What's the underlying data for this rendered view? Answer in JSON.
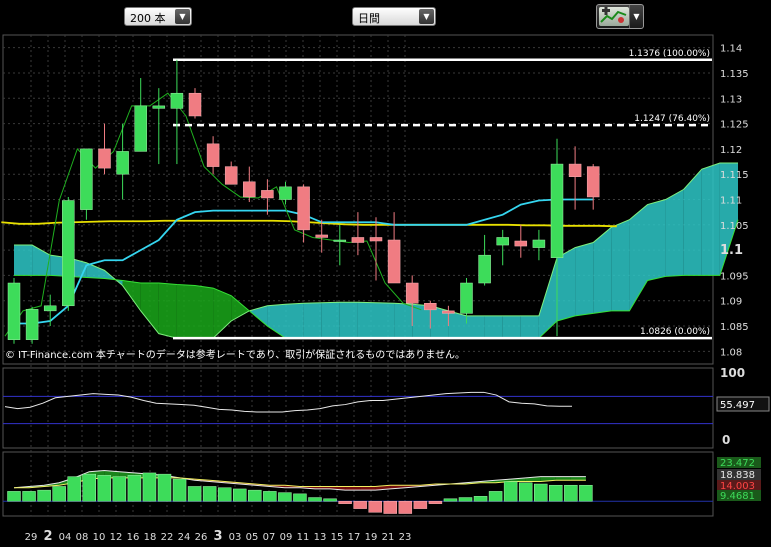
{
  "toolbar": {
    "bars_select": "200 本",
    "timeframe_select": "日間",
    "tool_icon": "chart-tools-icon"
  },
  "copyright": "© IT-Finance.com  本チャートのデータは参考レートであり、取引が保証されるものではありません。",
  "colors": {
    "up": "#3ddc5a",
    "down": "#f07c82",
    "tenkan": "#35d6f0",
    "kijun": "#e8e000",
    "cloud_teal": "#2ec8c8",
    "cloud_green": "#1aa81a",
    "grid": "#3a3a3a",
    "blue_line": "#3333cc"
  },
  "chart_data": [
    {
      "type": "candlestick",
      "title": "",
      "y_ticks": [
        "1.14",
        "1.135",
        "1.13",
        "1.125",
        "1.12",
        "1.115",
        "1.11",
        "1.105",
        "1.1",
        "1.095",
        "1.09",
        "1.085",
        "1.08"
      ],
      "ylim": [
        1.0775,
        1.1425
      ],
      "x_ticks": [
        "29",
        "2",
        "04",
        "08",
        "10",
        "12",
        "16",
        "18",
        "22",
        "24",
        "26",
        "3",
        "03",
        "05",
        "07",
        "09",
        "11",
        "13",
        "15",
        "17",
        "19",
        "21",
        "23"
      ],
      "fib_levels": [
        {
          "label": "1.1376 (100.00%)",
          "value": 1.1376
        },
        {
          "label": "1.1247 (76.40%)",
          "value": 1.1247
        },
        {
          "label": "1.0826 (0.00%)",
          "value": 1.0826
        }
      ],
      "candles": [
        {
          "o": 1.0823,
          "h": 1.0945,
          "l": 1.0815,
          "c": 1.0935
        },
        {
          "o": 1.0823,
          "h": 1.0888,
          "l": 1.0815,
          "c": 1.0883
        },
        {
          "o": 1.088,
          "h": 1.0912,
          "l": 1.085,
          "c": 1.089
        },
        {
          "o": 1.089,
          "h": 1.1105,
          "l": 1.088,
          "c": 1.1098
        },
        {
          "o": 1.108,
          "h": 1.12,
          "l": 1.106,
          "c": 1.12
        },
        {
          "o": 1.12,
          "h": 1.125,
          "l": 1.115,
          "c": 1.1162
        },
        {
          "o": 1.115,
          "h": 1.125,
          "l": 1.11,
          "c": 1.1195
        },
        {
          "o": 1.1195,
          "h": 1.134,
          "l": 1.1195,
          "c": 1.1285
        },
        {
          "o": 1.128,
          "h": 1.132,
          "l": 1.117,
          "c": 1.1285
        },
        {
          "o": 1.128,
          "h": 1.1376,
          "l": 1.117,
          "c": 1.131
        },
        {
          "o": 1.131,
          "h": 1.132,
          "l": 1.126,
          "c": 1.1265
        },
        {
          "o": 1.121,
          "h": 1.1225,
          "l": 1.115,
          "c": 1.1165
        },
        {
          "o": 1.1165,
          "h": 1.1175,
          "l": 1.113,
          "c": 1.113
        },
        {
          "o": 1.1135,
          "h": 1.1165,
          "l": 1.1095,
          "c": 1.1105
        },
        {
          "o": 1.1118,
          "h": 1.114,
          "l": 1.107,
          "c": 1.1103
        },
        {
          "o": 1.11,
          "h": 1.1135,
          "l": 1.109,
          "c": 1.1125
        },
        {
          "o": 1.1125,
          "h": 1.113,
          "l": 1.1015,
          "c": 1.104
        },
        {
          "o": 1.103,
          "h": 1.106,
          "l": 1.0995,
          "c": 1.1025
        },
        {
          "o": 1.102,
          "h": 1.105,
          "l": 1.097,
          "c": 1.102
        },
        {
          "o": 1.1025,
          "h": 1.1075,
          "l": 1.099,
          "c": 1.1015
        },
        {
          "o": 1.1025,
          "h": 1.1065,
          "l": 1.094,
          "c": 1.1018
        },
        {
          "o": 1.102,
          "h": 1.1075,
          "l": 1.0935,
          "c": 1.0935
        },
        {
          "o": 1.0935,
          "h": 1.095,
          "l": 1.085,
          "c": 1.0895
        },
        {
          "o": 1.0895,
          "h": 1.09,
          "l": 1.0845,
          "c": 1.0882
        },
        {
          "o": 1.088,
          "h": 1.089,
          "l": 1.085,
          "c": 1.0875
        },
        {
          "o": 1.0875,
          "h": 1.0945,
          "l": 1.0855,
          "c": 1.0935
        },
        {
          "o": 1.0935,
          "h": 1.103,
          "l": 1.093,
          "c": 1.099
        },
        {
          "o": 1.101,
          "h": 1.104,
          "l": 1.097,
          "c": 1.1025
        },
        {
          "o": 1.1018,
          "h": 1.105,
          "l": 1.0985,
          "c": 1.1008
        },
        {
          "o": 1.1005,
          "h": 1.104,
          "l": 1.098,
          "c": 1.102
        },
        {
          "o": 1.0985,
          "h": 1.122,
          "l": 1.083,
          "c": 1.117
        },
        {
          "o": 1.117,
          "h": 1.1205,
          "l": 1.108,
          "c": 1.1145
        },
        {
          "o": 1.1165,
          "h": 1.117,
          "l": 1.108,
          "c": 1.1105
        }
      ],
      "tenkan": [
        1.0855,
        1.0855,
        1.086,
        1.089,
        1.097,
        1.098,
        1.098,
        1.1,
        1.102,
        1.106,
        1.1075,
        1.1078,
        1.1078,
        1.1078,
        1.1078,
        1.1078,
        1.107,
        1.1055,
        1.1055,
        1.1055,
        1.1055,
        1.105,
        1.105,
        1.105,
        1.105,
        1.105,
        1.106,
        1.107,
        1.109,
        1.1098,
        1.11,
        1.11,
        1.11
      ],
      "kijun": [
        1.1055,
        1.1052,
        1.1052,
        1.1054,
        1.1055,
        1.1056,
        1.1057,
        1.1057,
        1.1057,
        1.1058,
        1.1058,
        1.1058,
        1.1058,
        1.1058,
        1.1058,
        1.1058,
        1.1057,
        1.1055,
        1.1053,
        1.1051,
        1.105,
        1.105,
        1.105,
        1.105,
        1.105,
        1.105,
        1.105,
        1.105,
        1.105,
        1.1049,
        1.1049,
        1.1048,
        1.1048,
        1.1048,
        1.1047
      ],
      "cloud_a": [
        1.101,
        1.101,
        1.099,
        1.0985,
        1.0975,
        1.096,
        1.093,
        1.088,
        1.0835,
        1.0826,
        1.0826,
        1.0826,
        1.086,
        1.088,
        1.089,
        1.0893,
        1.0895,
        1.0896,
        1.0897,
        1.0897,
        1.0896,
        1.0895,
        1.0893,
        1.089,
        1.088,
        1.087,
        1.087,
        1.087,
        1.087,
        1.087,
        1.0985,
        1.1005,
        1.1015,
        1.1045,
        1.106,
        1.109,
        1.11,
        1.112,
        1.116,
        1.1172,
        1.1172
      ],
      "cloud_b": [
        1.095,
        1.095,
        1.095,
        1.0948,
        1.0946,
        1.0944,
        1.094,
        1.0935,
        1.0935,
        1.0932,
        1.093,
        1.0925,
        1.091,
        1.088,
        1.085,
        1.0826,
        1.0826,
        1.0826,
        1.0826,
        1.0826,
        1.0826,
        1.0826,
        1.0826,
        1.0826,
        1.0826,
        1.0826,
        1.0826,
        1.0826,
        1.0826,
        1.0826,
        1.086,
        1.087,
        1.0875,
        1.088,
        1.088,
        1.094,
        1.0948,
        1.095,
        1.095,
        1.095,
        1.106
      ],
      "chikou": [
        1.083,
        1.088,
        1.089,
        1.1098,
        1.12,
        1.1162,
        1.1195,
        1.1285,
        1.1285,
        1.131,
        1.1265,
        1.1165,
        1.113,
        1.1105,
        1.1103,
        1.1125,
        1.104,
        1.1025,
        1.102,
        1.1015,
        1.1018,
        1.0935,
        1.0895,
        1.0882
      ]
    },
    {
      "type": "line",
      "title": "",
      "y_ticks": [
        "100",
        "0"
      ],
      "ylim": [
        0,
        100
      ],
      "last_label": "55.497",
      "bands": [
        70,
        30
      ],
      "values": [
        55,
        52,
        54,
        60,
        68,
        70,
        72,
        74,
        73,
        72,
        69,
        64,
        60,
        59,
        58,
        57,
        54,
        51,
        50,
        48,
        47,
        47,
        47,
        49,
        50,
        52,
        56,
        58,
        62,
        64,
        64,
        66,
        68,
        70,
        72,
        74,
        75,
        76,
        76,
        72,
        62,
        60,
        59,
        56,
        55.5,
        55.5
      ]
    },
    {
      "type": "histogram",
      "title": "",
      "labels": [
        "23.472",
        "18.838",
        "14.003",
        "9.4681"
      ],
      "ylim": [
        -12,
        40
      ],
      "values": [
        8,
        8,
        9,
        12,
        20,
        22,
        21,
        20,
        21,
        23,
        22,
        18,
        12,
        12,
        11,
        10,
        9,
        8,
        7,
        6,
        3,
        2,
        -2,
        -6,
        -9,
        -10,
        -10,
        -6,
        -2,
        2,
        3,
        4,
        8,
        16,
        15,
        14,
        13,
        13,
        13
      ],
      "macd_a": [
        11,
        12,
        13,
        15,
        19,
        24,
        25,
        24,
        23,
        22,
        21,
        19,
        17,
        16,
        15,
        14,
        13,
        12,
        11,
        11,
        10,
        10,
        9,
        9,
        9,
        10,
        11,
        12,
        13,
        14,
        15,
        16,
        17,
        18,
        19,
        20,
        20,
        20,
        20
      ],
      "macd_b": [
        11,
        11,
        12,
        13,
        15,
        18,
        19,
        19,
        19,
        19,
        19,
        19,
        18,
        17,
        16,
        15,
        14,
        13,
        13,
        12,
        12,
        12,
        12,
        12,
        12,
        13,
        13,
        13,
        14,
        14,
        14,
        15,
        15,
        16,
        16,
        16,
        17,
        17,
        17
      ]
    }
  ]
}
